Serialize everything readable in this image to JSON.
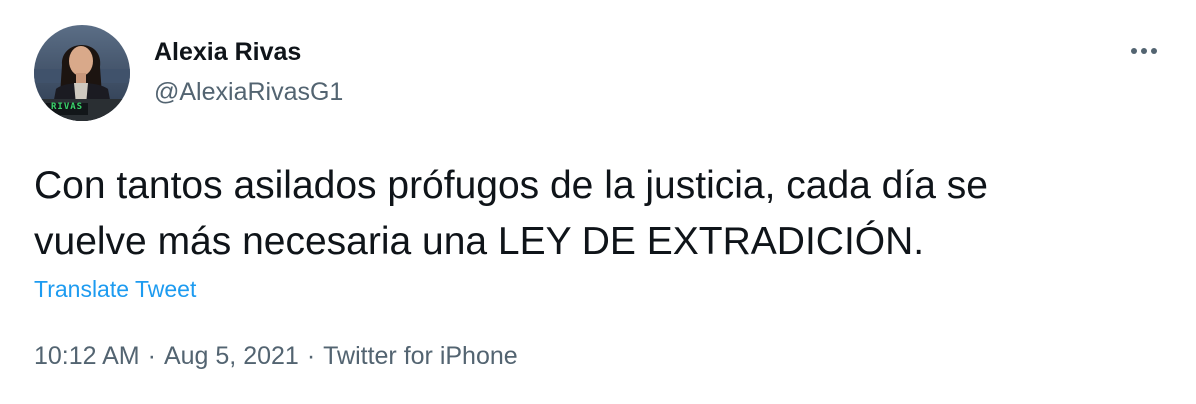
{
  "user": {
    "display_name": "Alexia Rivas",
    "handle": "@AlexiaRivasG1",
    "avatar_badge_text": "RIVAS"
  },
  "tweet": {
    "text_line1": "Con tantos asilados prófugos de la justicia, cada día se",
    "text_line2": "vuelve más necesaria una LEY DE EXTRADICIÓN.",
    "translate_label": "Translate Tweet"
  },
  "meta": {
    "time": "10:12 AM",
    "separator": "·",
    "date": "Aug 5, 2021",
    "source": "Twitter for iPhone"
  },
  "icons": {
    "more": "more-options-icon"
  },
  "colors": {
    "text_primary": "#0f1419",
    "text_secondary": "#536471",
    "link": "#1d9bf0",
    "background": "#ffffff"
  }
}
